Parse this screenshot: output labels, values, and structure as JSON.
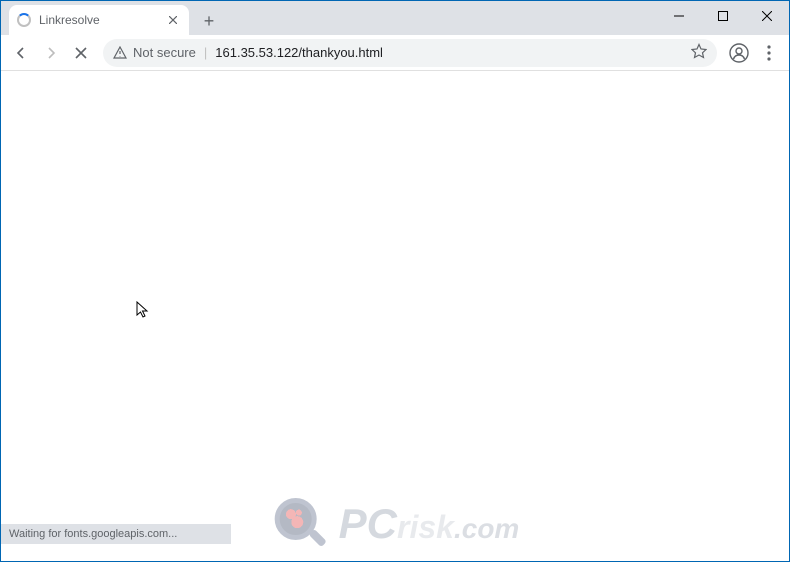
{
  "window": {
    "minimize_title": "Minimize",
    "maximize_title": "Maximize",
    "close_title": "Close"
  },
  "tab": {
    "title": "Linkresolve",
    "loading": true
  },
  "new_tab": {
    "label": "+"
  },
  "toolbar": {
    "back_title": "Back",
    "forward_title": "Forward",
    "stop_title": "Stop",
    "security_label": "Not secure",
    "url": "161.35.53.122/thankyou.html",
    "bookmark_title": "Bookmark",
    "profile_title": "You",
    "menu_title": "Menu"
  },
  "status": {
    "text": "Waiting for fonts.googleapis.com..."
  },
  "watermark": {
    "pc": "PC",
    "risk": "risk",
    "com": ".com"
  }
}
